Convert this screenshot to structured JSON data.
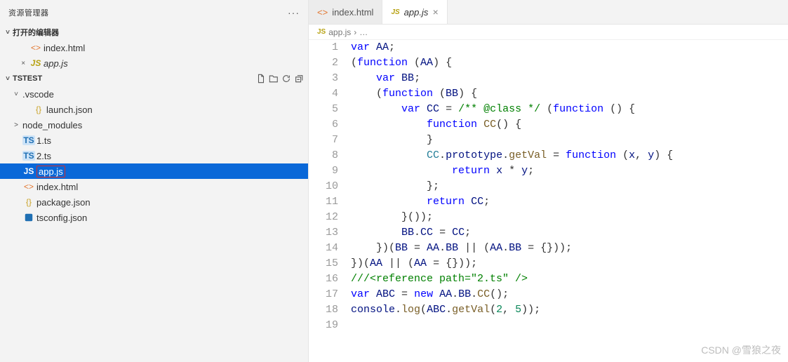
{
  "sidebar": {
    "title": "资源管理器",
    "open_editors_title": "打开的编辑器",
    "open_editors": [
      {
        "pre": "",
        "icon": "html",
        "name": "index.html",
        "italic": false
      },
      {
        "pre": "×",
        "icon": "js",
        "name": "app.js",
        "italic": true
      }
    ],
    "project_title": "TSTEST",
    "actions": [
      "new-file",
      "new-folder",
      "refresh",
      "collapse"
    ],
    "tree": [
      {
        "depth": 0,
        "chev": "˅",
        "icon": "",
        "name": ".vscode"
      },
      {
        "depth": 1,
        "chev": "",
        "icon": "json",
        "name": "launch.json"
      },
      {
        "depth": 0,
        "chev": ">",
        "icon": "",
        "name": "node_modules"
      },
      {
        "depth": 0,
        "chev": "",
        "icon": "ts",
        "name": "1.ts"
      },
      {
        "depth": 0,
        "chev": "",
        "icon": "ts",
        "name": "2.ts"
      },
      {
        "depth": 0,
        "chev": "",
        "icon": "js",
        "name": "app.js",
        "selected": true
      },
      {
        "depth": 0,
        "chev": "",
        "icon": "html",
        "name": "index.html"
      },
      {
        "depth": 0,
        "chev": "",
        "icon": "json",
        "name": "package.json"
      },
      {
        "depth": 0,
        "chev": "",
        "icon": "tsconfig",
        "name": "tsconfig.json"
      }
    ]
  },
  "tabs": [
    {
      "icon": "html",
      "label": "index.html",
      "active": false,
      "italic": false,
      "close": false
    },
    {
      "icon": "js",
      "label": "app.js",
      "active": true,
      "italic": true,
      "close": true
    }
  ],
  "breadcrumb": {
    "icon": "js",
    "file": "app.js",
    "sep": "›",
    "tail": "…"
  },
  "code": {
    "lines": [
      [
        [
          "kw",
          "var"
        ],
        [
          "",
          " "
        ],
        [
          "var",
          "AA"
        ],
        [
          "",
          ";"
        ]
      ],
      [
        [
          "",
          "("
        ],
        [
          "kw",
          "function"
        ],
        [
          "",
          " ("
        ],
        [
          "var",
          "AA"
        ],
        [
          "",
          ") {"
        ]
      ],
      [
        [
          "",
          "    "
        ],
        [
          "kw",
          "var"
        ],
        [
          "",
          " "
        ],
        [
          "var",
          "BB"
        ],
        [
          "",
          ";"
        ]
      ],
      [
        [
          "",
          "    ("
        ],
        [
          "kw",
          "function"
        ],
        [
          "",
          " ("
        ],
        [
          "var",
          "BB"
        ],
        [
          "",
          ") {"
        ]
      ],
      [
        [
          "",
          "        "
        ],
        [
          "kw",
          "var"
        ],
        [
          "",
          " "
        ],
        [
          "var",
          "CC"
        ],
        [
          "",
          " = "
        ],
        [
          "com",
          "/** @class */"
        ],
        [
          "",
          " ("
        ],
        [
          "kw",
          "function"
        ],
        [
          "",
          " () {"
        ]
      ],
      [
        [
          "",
          "            "
        ],
        [
          "kw",
          "function"
        ],
        [
          "",
          " "
        ],
        [
          "fn",
          "CC"
        ],
        [
          "",
          "() {"
        ]
      ],
      [
        [
          "",
          "            }"
        ]
      ],
      [
        [
          "",
          "            "
        ],
        [
          "type",
          "CC"
        ],
        [
          "",
          "."
        ],
        [
          "var",
          "prototype"
        ],
        [
          "",
          "."
        ],
        [
          "fn",
          "getVal"
        ],
        [
          "",
          " = "
        ],
        [
          "kw",
          "function"
        ],
        [
          "",
          " ("
        ],
        [
          "var",
          "x"
        ],
        [
          "",
          ", "
        ],
        [
          "var",
          "y"
        ],
        [
          "",
          ") {"
        ]
      ],
      [
        [
          "",
          "                "
        ],
        [
          "kw",
          "return"
        ],
        [
          "",
          " "
        ],
        [
          "var",
          "x"
        ],
        [
          "",
          " * "
        ],
        [
          "var",
          "y"
        ],
        [
          "",
          ";"
        ]
      ],
      [
        [
          "",
          "            };"
        ]
      ],
      [
        [
          "",
          "            "
        ],
        [
          "kw",
          "return"
        ],
        [
          "",
          " "
        ],
        [
          "var",
          "CC"
        ],
        [
          "",
          ";"
        ]
      ],
      [
        [
          "",
          "        }());"
        ]
      ],
      [
        [
          "",
          "        "
        ],
        [
          "var",
          "BB"
        ],
        [
          "",
          "."
        ],
        [
          "var",
          "CC"
        ],
        [
          "",
          " = "
        ],
        [
          "var",
          "CC"
        ],
        [
          "",
          ";"
        ]
      ],
      [
        [
          "",
          "    })("
        ],
        [
          "var",
          "BB"
        ],
        [
          "",
          " = "
        ],
        [
          "var",
          "AA"
        ],
        [
          "",
          "."
        ],
        [
          "var",
          "BB"
        ],
        [
          "",
          " || ("
        ],
        [
          "var",
          "AA"
        ],
        [
          "",
          "."
        ],
        [
          "var",
          "BB"
        ],
        [
          "",
          " = {}));"
        ]
      ],
      [
        [
          "",
          "})("
        ],
        [
          "var",
          "AA"
        ],
        [
          "",
          " || ("
        ],
        [
          "var",
          "AA"
        ],
        [
          "",
          " = {}));"
        ]
      ],
      [
        [
          "com",
          "///<reference path=\"2.ts\" />"
        ]
      ],
      [
        [
          "kw",
          "var"
        ],
        [
          "",
          " "
        ],
        [
          "var",
          "ABC"
        ],
        [
          "",
          " = "
        ],
        [
          "kw",
          "new"
        ],
        [
          "",
          " "
        ],
        [
          "var",
          "AA"
        ],
        [
          "",
          "."
        ],
        [
          "var",
          "BB"
        ],
        [
          "",
          "."
        ],
        [
          "fn",
          "CC"
        ],
        [
          "",
          "();"
        ]
      ],
      [
        [
          "var",
          "console"
        ],
        [
          "",
          "."
        ],
        [
          "fn",
          "log"
        ],
        [
          "",
          "("
        ],
        [
          "var",
          "ABC"
        ],
        [
          "",
          "."
        ],
        [
          "fn",
          "getVal"
        ],
        [
          "",
          "("
        ],
        [
          "num",
          "2"
        ],
        [
          "",
          ", "
        ],
        [
          "num",
          "5"
        ],
        [
          "",
          "));"
        ]
      ],
      [
        [
          "",
          ""
        ]
      ]
    ]
  },
  "watermark": "CSDN @雪狼之夜"
}
